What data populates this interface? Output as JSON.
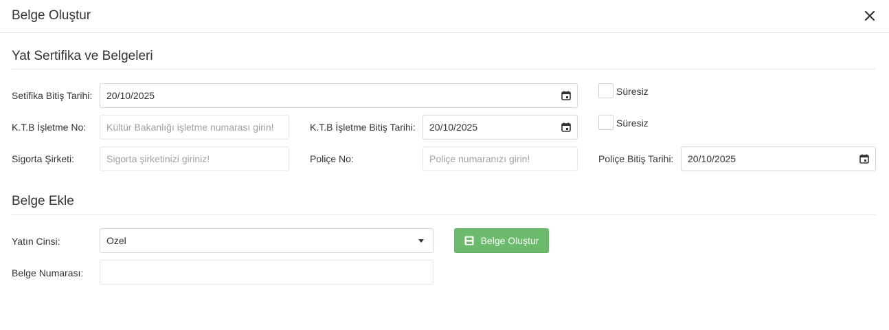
{
  "modal": {
    "title": "Belge Oluştur",
    "close_icon": "close-icon"
  },
  "section1": {
    "title": "Yat Sertifika ve Belgeleri",
    "cert_end_label": "Setifika Bitiş Tarihi:",
    "cert_end_value": "20/10/2025",
    "cert_unlimited_label": "Süresiz",
    "ktb_no_label": "K.T.B İşletme No:",
    "ktb_no_placeholder": "Kültür Bakanlığı işletme numarası girin!",
    "ktb_end_label": "K.T.B İşletme Bitiş Tarihi:",
    "ktb_end_value": "20/10/2025",
    "ktb_unlimited_label": "Süresiz",
    "insurance_label": "Sigorta Şirketi:",
    "insurance_placeholder": "Sigorta şirketinizi giriniz!",
    "policy_no_label": "Poliçe No:",
    "policy_no_placeholder": "Poliçe numaranızı girin!",
    "policy_end_label": "Poliçe Bitiş Tarihi:",
    "policy_end_value": "20/10/2025"
  },
  "section2": {
    "title": "Belge Ekle",
    "yacht_type_label": "Yatın Cinsi:",
    "yacht_type_value": "Ozel",
    "create_button_label": "Belge Oluştur",
    "doc_number_label": "Belge Numarası:",
    "doc_number_value": ""
  },
  "colors": {
    "success": "#6cba6c",
    "border": "#d2d6de",
    "divider": "#e5e5e5",
    "text": "#333333",
    "placeholder": "#a0a0a0"
  },
  "icons": {
    "calendar": "calendar-icon",
    "dropdown": "chevron-down-icon",
    "save": "save-icon"
  }
}
